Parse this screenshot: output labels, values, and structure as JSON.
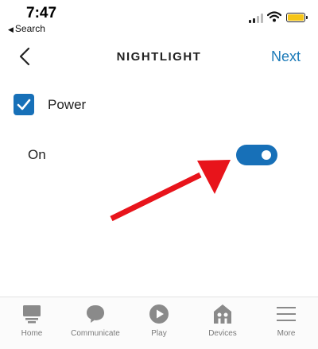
{
  "status_bar": {
    "time": "7:47",
    "back_app_label": "Search",
    "battery_color": "#f5c518"
  },
  "header": {
    "back_icon": "chevron-left-icon",
    "title": "NIGHTLIGHT",
    "next_label": "Next"
  },
  "power": {
    "label": "Power",
    "checked": true
  },
  "on_setting": {
    "label": "On",
    "toggle_on": true
  },
  "annotation": {
    "arrow_color": "#e8141b"
  },
  "bottom_nav": {
    "items": [
      {
        "label": "Home",
        "icon": "home-icon"
      },
      {
        "label": "Communicate",
        "icon": "chat-bubble-icon"
      },
      {
        "label": "Play",
        "icon": "play-icon"
      },
      {
        "label": "Devices",
        "icon": "devices-icon"
      },
      {
        "label": "More",
        "icon": "menu-icon"
      }
    ]
  },
  "colors": {
    "accent": "#1770b8",
    "link": "#1b7ab8",
    "nav_icon": "#8a8a8a"
  }
}
